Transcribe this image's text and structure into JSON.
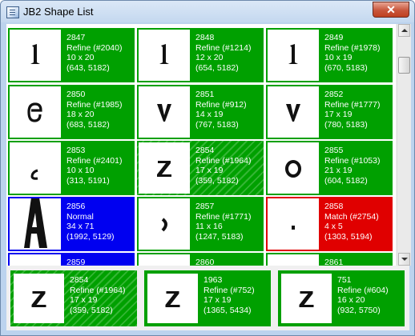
{
  "window": {
    "title": "JB2 Shape List",
    "close_label": "✕"
  },
  "shapes": [
    {
      "id": "2847",
      "status": "Refine (#2040)",
      "size": "10 x 20",
      "pos": "(643, 5182)",
      "glyph": "l",
      "color": "green"
    },
    {
      "id": "2848",
      "status": "Refine (#1214)",
      "size": "12 x 20",
      "pos": "(654, 5182)",
      "glyph": "l",
      "color": "green"
    },
    {
      "id": "2849",
      "status": "Refine (#1978)",
      "size": "10 x 19",
      "pos": "(670, 5183)",
      "glyph": "l",
      "color": "green"
    },
    {
      "id": "2850",
      "status": "Refine (#1985)",
      "size": "18 x 20",
      "pos": "(683, 5182)",
      "glyph": "e",
      "color": "green"
    },
    {
      "id": "2851",
      "status": "Refine (#912)",
      "size": "14 x 19",
      "pos": "(767, 5183)",
      "glyph": "v",
      "color": "green"
    },
    {
      "id": "2852",
      "status": "Refine (#1777)",
      "size": "17 x 19",
      "pos": "(780, 5183)",
      "glyph": "v",
      "color": "green"
    },
    {
      "id": "2853",
      "status": "Refine (#2401)",
      "size": "10 x 10",
      "pos": "(313, 5191)",
      "glyph": "c",
      "color": "green"
    },
    {
      "id": "2854",
      "status": "Refine (#1964)",
      "size": "17 x 19",
      "pos": "(359, 5182)",
      "glyph": "z",
      "color": "striped"
    },
    {
      "id": "2855",
      "status": "Refine (#1053)",
      "size": "21 x 19",
      "pos": "(604, 5182)",
      "glyph": "o",
      "color": "green"
    },
    {
      "id": "2856",
      "status": "Normal",
      "size": "34 x 71",
      "pos": "(1992, 5129)",
      "glyph": "A",
      "color": "blue"
    },
    {
      "id": "2857",
      "status": "Refine (#1771)",
      "size": "11 x 16",
      "pos": "(1247, 5183)",
      "glyph": "paren",
      "color": "green"
    },
    {
      "id": "2858",
      "status": "Match (#2754)",
      "size": "4 x 5",
      "pos": "(1303, 5194)",
      "glyph": "dot",
      "color": "red"
    },
    {
      "id": "2859",
      "status": "",
      "size": "",
      "pos": "",
      "glyph": "A2",
      "color": "blue"
    },
    {
      "id": "2860",
      "status": "",
      "size": "",
      "pos": "",
      "glyph": "none",
      "color": "green"
    },
    {
      "id": "2861",
      "status": "",
      "size": "",
      "pos": "",
      "glyph": "none",
      "color": "green"
    }
  ],
  "matches": [
    {
      "id": "2854",
      "status": "Refine (#1964)",
      "size": "17 x 19",
      "pos": "(359, 5182)",
      "glyph": "z",
      "color": "striped"
    },
    {
      "id": "1963",
      "status": "Refine (#752)",
      "size": "17 x 19",
      "pos": "(1365, 5434)",
      "glyph": "z",
      "color": "green"
    },
    {
      "id": "751",
      "status": "Refine (#604)",
      "size": "16 x 20",
      "pos": "(932, 5750)",
      "glyph": "z",
      "color": "green"
    }
  ]
}
